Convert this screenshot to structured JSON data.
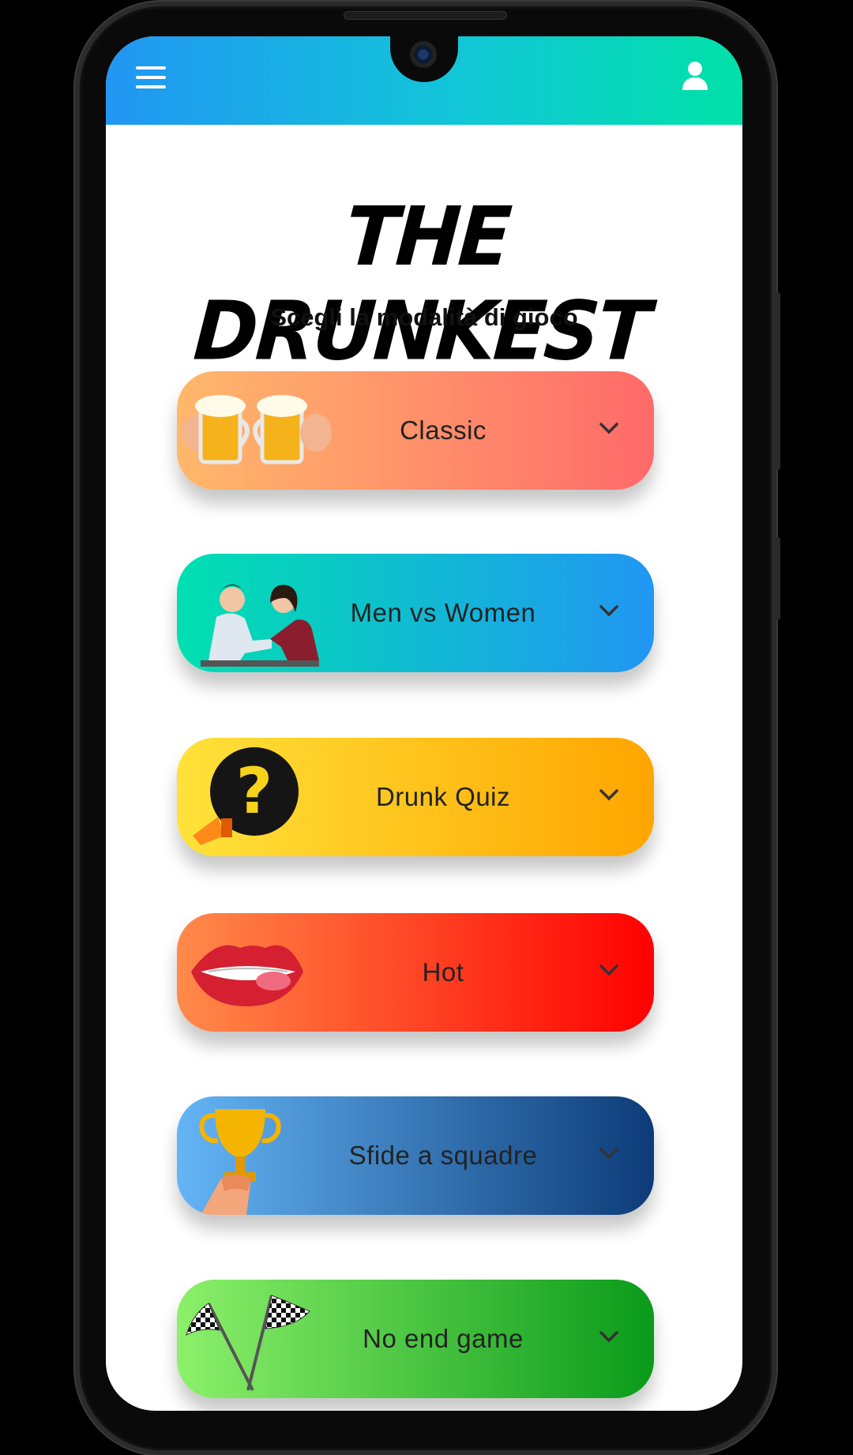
{
  "app": {
    "title": "THE DRUNKEST",
    "subtitle": "Scegli la modalità di gioco"
  },
  "topbar": {
    "menu_icon": "hamburger-menu-icon",
    "profile_icon": "user-icon"
  },
  "modes": [
    {
      "label": "Classic",
      "icon": "beer-mugs-icon",
      "gradient": [
        "#ffb86b",
        "#ff6a6a"
      ]
    },
    {
      "label": "Men vs Women",
      "icon": "arm-wrestling-icon",
      "gradient": [
        "#00e0b0",
        "#2196f3"
      ]
    },
    {
      "label": "Drunk Quiz",
      "icon": "question-megaphone-icon",
      "gradient": [
        "#ffe23a",
        "#ffa500"
      ]
    },
    {
      "label": "Hot",
      "icon": "lips-icon",
      "gradient": [
        "#ff8a4a",
        "#ff0000"
      ]
    },
    {
      "label": "Sfide a squadre",
      "icon": "trophy-icon",
      "gradient": [
        "#64b5f6",
        "#0d3b78"
      ]
    },
    {
      "label": "No end game",
      "icon": "checkered-flags-icon",
      "gradient": [
        "#8cf06a",
        "#0a9a1a"
      ]
    }
  ]
}
